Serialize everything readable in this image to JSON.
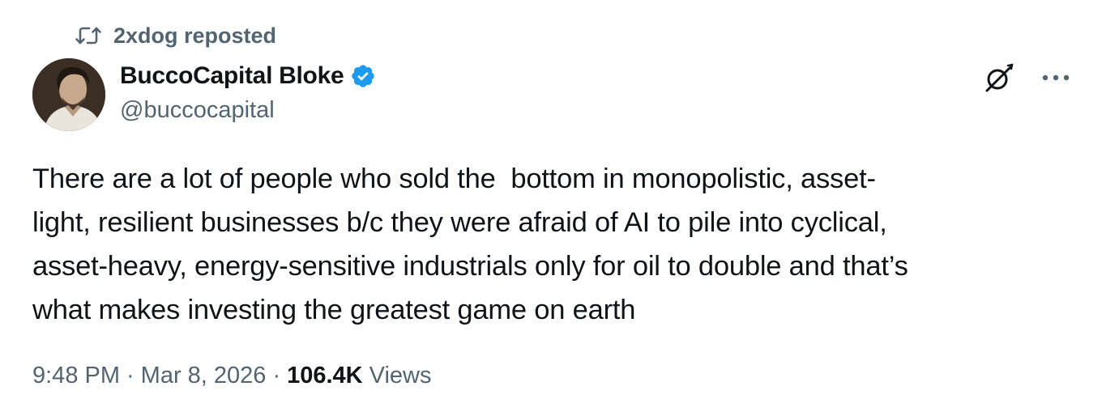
{
  "repost": {
    "icon": "repost-icon",
    "text": "2xdog reposted"
  },
  "author": {
    "avatar": "avatar",
    "display_name": "BuccoCapital Bloke",
    "verified_icon": "verified-badge-icon",
    "verified_color": "#1d9bf0",
    "handle": "@buccocapital"
  },
  "actions": {
    "grok_icon": "grok-icon",
    "more_icon": "more-options-icon"
  },
  "tweet": {
    "text": "There are a lot of people who sold the  bottom in monopolistic, asset-\nlight, resilient businesses b/c they were afraid of AI to pile into cyclical,\nasset-heavy, energy-sensitive industrials only for oil to double and that’s\nwhat makes investing the greatest game on earth"
  },
  "meta": {
    "time": "9:48 PM",
    "separator": "·",
    "date": "Mar 8, 2026",
    "views_count": "106.4K",
    "views_label": "Views"
  },
  "colors": {
    "text_primary": "#0f1419",
    "text_secondary": "#536471",
    "accent": "#1d9bf0"
  }
}
